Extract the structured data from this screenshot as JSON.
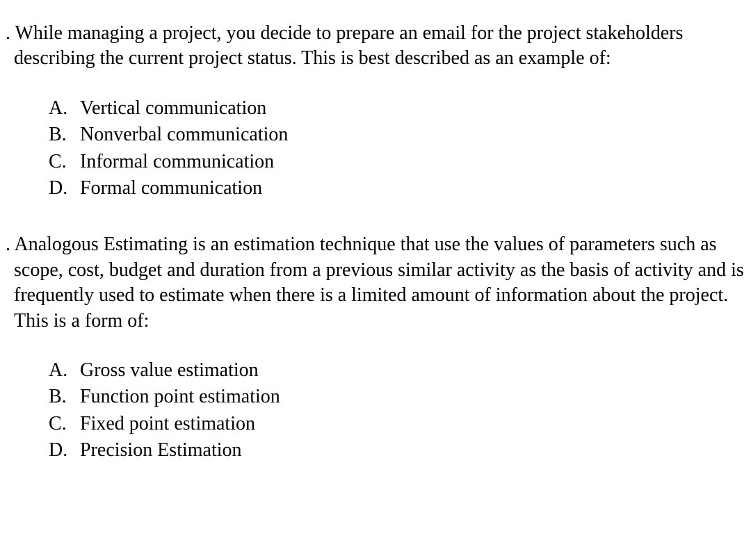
{
  "questions": [
    {
      "text": "While managing a project, you decide to prepare an email for the project stakeholders describing the current project status. This is best described as an example of:",
      "options": [
        {
          "letter": "A.",
          "text": "Vertical communication"
        },
        {
          "letter": "B.",
          "text": "Nonverbal communication"
        },
        {
          "letter": "C.",
          "text": "Informal communication"
        },
        {
          "letter": "D.",
          "text": "Formal communication"
        }
      ]
    },
    {
      "text": "Analogous Estimating is an estimation technique that use the values of parameters such as scope, cost, budget and duration from a previous similar activity as the basis of activity and is frequently used to estimate when there is a limited amount of information about the project. This is a form of:",
      "options": [
        {
          "letter": "A.",
          "text": "Gross value estimation"
        },
        {
          "letter": "B.",
          "text": "Function point estimation"
        },
        {
          "letter": "C.",
          "text": "Fixed point estimation"
        },
        {
          "letter": "D.",
          "text": "Precision Estimation"
        }
      ]
    }
  ]
}
